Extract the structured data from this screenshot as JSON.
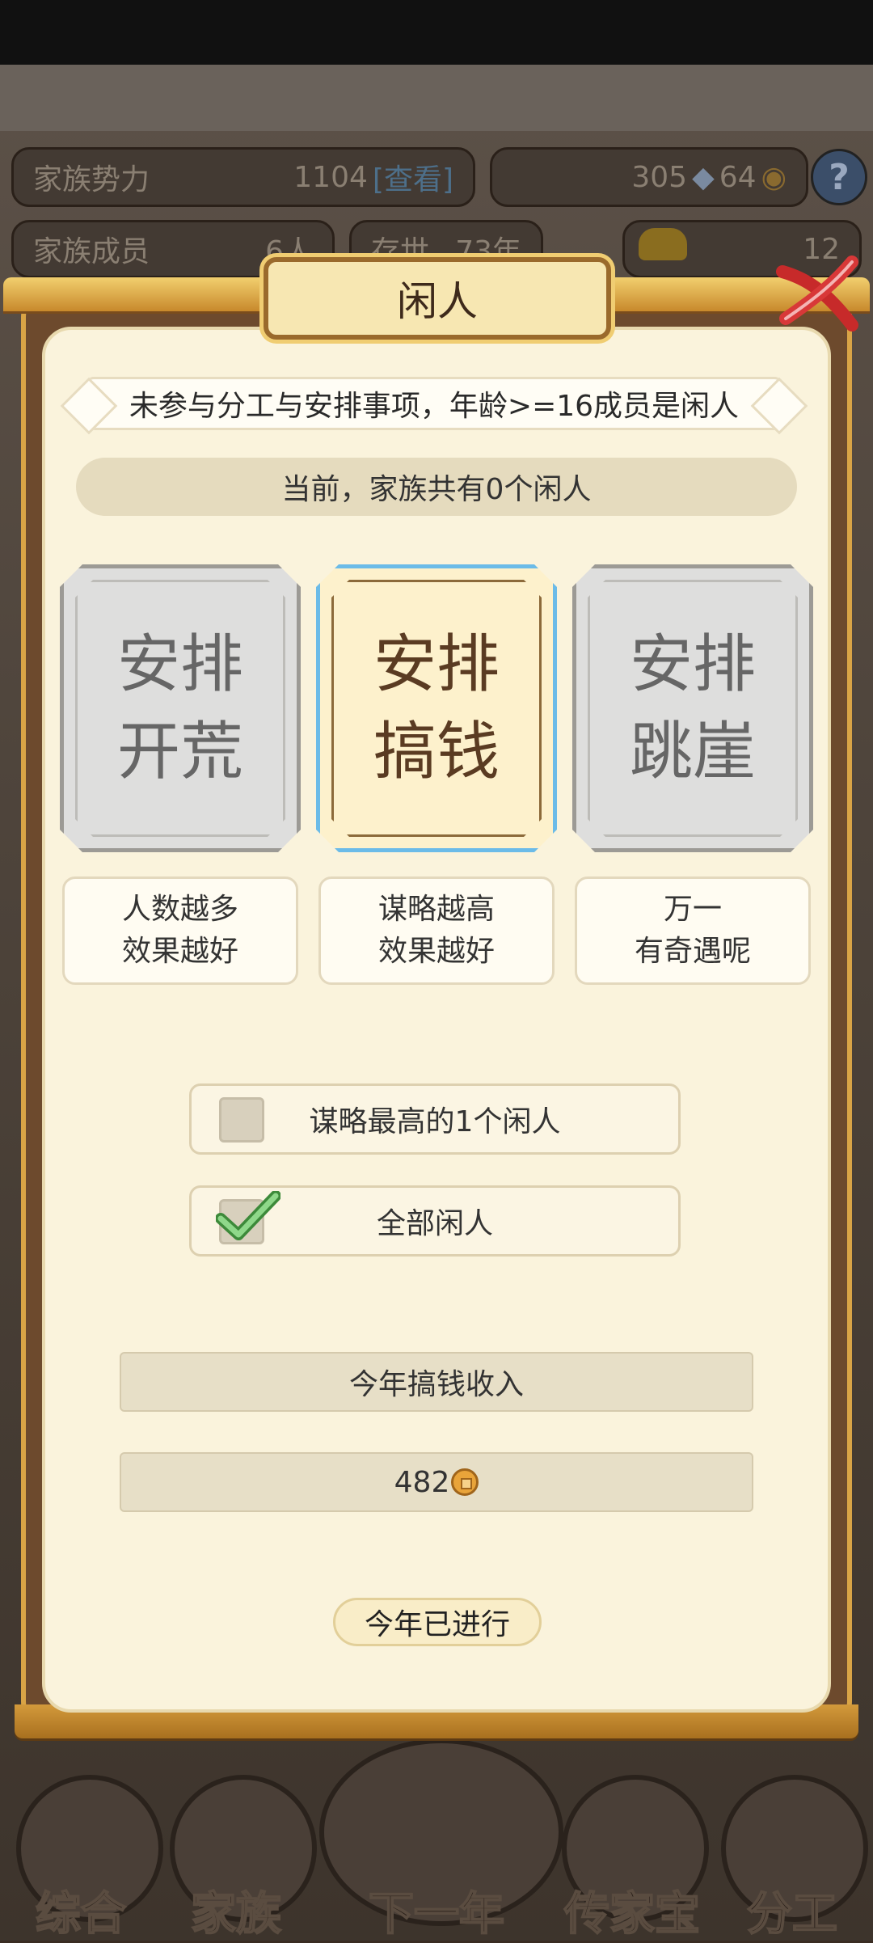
{
  "hud": {
    "power_label": "家族势力",
    "power_value": "1104",
    "power_link": "[查看]",
    "resource_1": "305",
    "resource_2": "64",
    "members_label": "家族成员",
    "members_value": "6人",
    "exist_label": "存世",
    "exist_value": "73年",
    "ingot_value": "12"
  },
  "dialog": {
    "title": "闲人",
    "rule_text": "未参与分工与安排事项，年龄>=16成员是闲人",
    "count_text": "当前，家族共有0个闲人",
    "options": [
      {
        "line1": "安排",
        "line2": "开荒",
        "desc1": "人数越多",
        "desc2": "效果越好",
        "selected": false
      },
      {
        "line1": "安排",
        "line2": "搞钱",
        "desc1": "谋略越高",
        "desc2": "效果越好",
        "selected": true
      },
      {
        "line1": "安排",
        "line2": "跳崖",
        "desc1": "万一",
        "desc2": "有奇遇呢",
        "selected": false
      }
    ],
    "check_top_one": {
      "label": "谋略最高的1个闲人",
      "checked": false
    },
    "check_all": {
      "label": "全部闲人",
      "checked": true
    },
    "income_label": "今年搞钱收入",
    "income_value": "482",
    "year_status": "今年已进行",
    "accent_color": "#6bbbe8"
  },
  "nav": [
    {
      "label": "综合"
    },
    {
      "label": "家族"
    },
    {
      "label": "下一年"
    },
    {
      "label": "传家宝"
    },
    {
      "label": "分工"
    }
  ]
}
